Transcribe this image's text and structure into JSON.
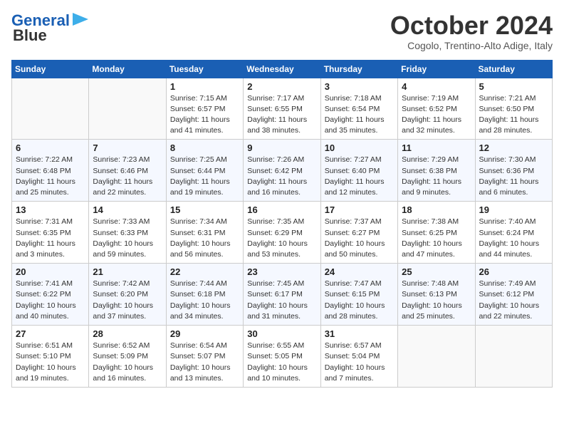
{
  "header": {
    "logo_line1": "General",
    "logo_line2": "Blue",
    "month": "October 2024",
    "location": "Cogolo, Trentino-Alto Adige, Italy"
  },
  "days_of_week": [
    "Sunday",
    "Monday",
    "Tuesday",
    "Wednesday",
    "Thursday",
    "Friday",
    "Saturday"
  ],
  "weeks": [
    [
      {
        "day": "",
        "info": ""
      },
      {
        "day": "",
        "info": ""
      },
      {
        "day": "1",
        "info": "Sunrise: 7:15 AM\nSunset: 6:57 PM\nDaylight: 11 hours and 41 minutes."
      },
      {
        "day": "2",
        "info": "Sunrise: 7:17 AM\nSunset: 6:55 PM\nDaylight: 11 hours and 38 minutes."
      },
      {
        "day": "3",
        "info": "Sunrise: 7:18 AM\nSunset: 6:54 PM\nDaylight: 11 hours and 35 minutes."
      },
      {
        "day": "4",
        "info": "Sunrise: 7:19 AM\nSunset: 6:52 PM\nDaylight: 11 hours and 32 minutes."
      },
      {
        "day": "5",
        "info": "Sunrise: 7:21 AM\nSunset: 6:50 PM\nDaylight: 11 hours and 28 minutes."
      }
    ],
    [
      {
        "day": "6",
        "info": "Sunrise: 7:22 AM\nSunset: 6:48 PM\nDaylight: 11 hours and 25 minutes."
      },
      {
        "day": "7",
        "info": "Sunrise: 7:23 AM\nSunset: 6:46 PM\nDaylight: 11 hours and 22 minutes."
      },
      {
        "day": "8",
        "info": "Sunrise: 7:25 AM\nSunset: 6:44 PM\nDaylight: 11 hours and 19 minutes."
      },
      {
        "day": "9",
        "info": "Sunrise: 7:26 AM\nSunset: 6:42 PM\nDaylight: 11 hours and 16 minutes."
      },
      {
        "day": "10",
        "info": "Sunrise: 7:27 AM\nSunset: 6:40 PM\nDaylight: 11 hours and 12 minutes."
      },
      {
        "day": "11",
        "info": "Sunrise: 7:29 AM\nSunset: 6:38 PM\nDaylight: 11 hours and 9 minutes."
      },
      {
        "day": "12",
        "info": "Sunrise: 7:30 AM\nSunset: 6:36 PM\nDaylight: 11 hours and 6 minutes."
      }
    ],
    [
      {
        "day": "13",
        "info": "Sunrise: 7:31 AM\nSunset: 6:35 PM\nDaylight: 11 hours and 3 minutes."
      },
      {
        "day": "14",
        "info": "Sunrise: 7:33 AM\nSunset: 6:33 PM\nDaylight: 10 hours and 59 minutes."
      },
      {
        "day": "15",
        "info": "Sunrise: 7:34 AM\nSunset: 6:31 PM\nDaylight: 10 hours and 56 minutes."
      },
      {
        "day": "16",
        "info": "Sunrise: 7:35 AM\nSunset: 6:29 PM\nDaylight: 10 hours and 53 minutes."
      },
      {
        "day": "17",
        "info": "Sunrise: 7:37 AM\nSunset: 6:27 PM\nDaylight: 10 hours and 50 minutes."
      },
      {
        "day": "18",
        "info": "Sunrise: 7:38 AM\nSunset: 6:25 PM\nDaylight: 10 hours and 47 minutes."
      },
      {
        "day": "19",
        "info": "Sunrise: 7:40 AM\nSunset: 6:24 PM\nDaylight: 10 hours and 44 minutes."
      }
    ],
    [
      {
        "day": "20",
        "info": "Sunrise: 7:41 AM\nSunset: 6:22 PM\nDaylight: 10 hours and 40 minutes."
      },
      {
        "day": "21",
        "info": "Sunrise: 7:42 AM\nSunset: 6:20 PM\nDaylight: 10 hours and 37 minutes."
      },
      {
        "day": "22",
        "info": "Sunrise: 7:44 AM\nSunset: 6:18 PM\nDaylight: 10 hours and 34 minutes."
      },
      {
        "day": "23",
        "info": "Sunrise: 7:45 AM\nSunset: 6:17 PM\nDaylight: 10 hours and 31 minutes."
      },
      {
        "day": "24",
        "info": "Sunrise: 7:47 AM\nSunset: 6:15 PM\nDaylight: 10 hours and 28 minutes."
      },
      {
        "day": "25",
        "info": "Sunrise: 7:48 AM\nSunset: 6:13 PM\nDaylight: 10 hours and 25 minutes."
      },
      {
        "day": "26",
        "info": "Sunrise: 7:49 AM\nSunset: 6:12 PM\nDaylight: 10 hours and 22 minutes."
      }
    ],
    [
      {
        "day": "27",
        "info": "Sunrise: 6:51 AM\nSunset: 5:10 PM\nDaylight: 10 hours and 19 minutes."
      },
      {
        "day": "28",
        "info": "Sunrise: 6:52 AM\nSunset: 5:09 PM\nDaylight: 10 hours and 16 minutes."
      },
      {
        "day": "29",
        "info": "Sunrise: 6:54 AM\nSunset: 5:07 PM\nDaylight: 10 hours and 13 minutes."
      },
      {
        "day": "30",
        "info": "Sunrise: 6:55 AM\nSunset: 5:05 PM\nDaylight: 10 hours and 10 minutes."
      },
      {
        "day": "31",
        "info": "Sunrise: 6:57 AM\nSunset: 5:04 PM\nDaylight: 10 hours and 7 minutes."
      },
      {
        "day": "",
        "info": ""
      },
      {
        "day": "",
        "info": ""
      }
    ]
  ]
}
